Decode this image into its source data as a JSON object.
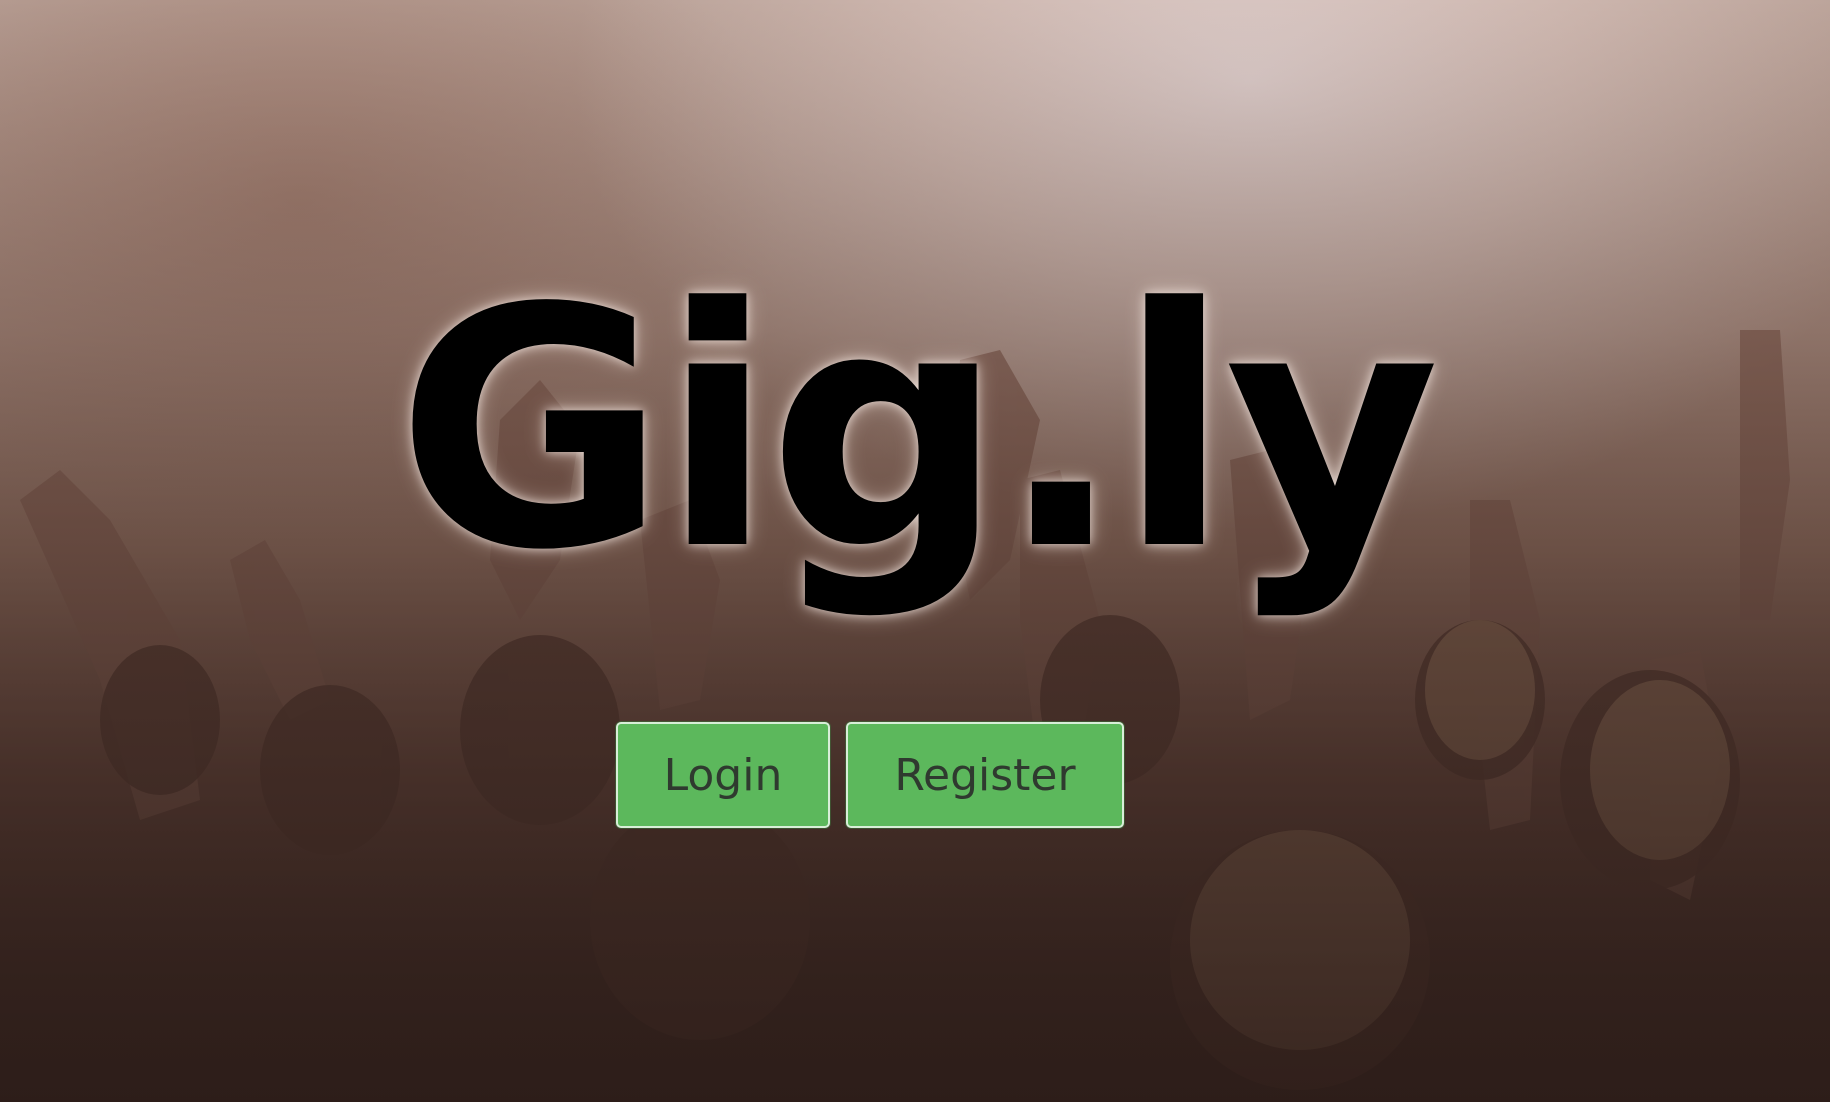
{
  "brand": {
    "title": "Gig.ly"
  },
  "actions": {
    "login_label": "Login",
    "register_label": "Register"
  },
  "colors": {
    "button_bg": "#5cb85c",
    "button_text": "#2f3a2f",
    "title": "#000000"
  },
  "background": {
    "image": "concert-crowd-photo"
  }
}
